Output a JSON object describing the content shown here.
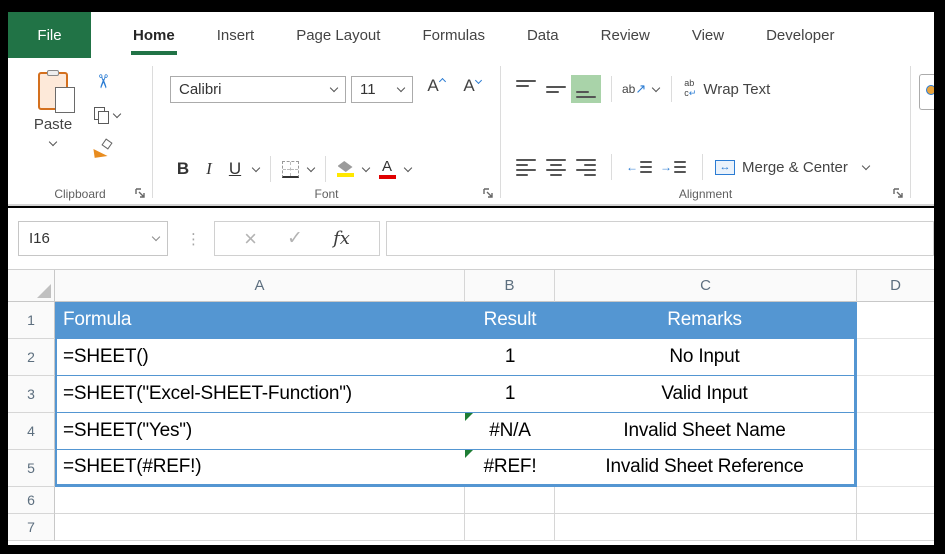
{
  "colors": {
    "excel_green": "#217346",
    "table_blue": "#5496d2",
    "selection_green": "#a9d3a9",
    "error_indicator_green": "#1e7d35",
    "fill_yellow": "#ffe800",
    "font_red": "#e00000"
  },
  "tabs": {
    "file": "File",
    "items": [
      {
        "label": "Home",
        "active": true
      },
      {
        "label": "Insert",
        "active": false
      },
      {
        "label": "Page Layout",
        "active": false
      },
      {
        "label": "Formulas",
        "active": false
      },
      {
        "label": "Data",
        "active": false
      },
      {
        "label": "Review",
        "active": false
      },
      {
        "label": "View",
        "active": false
      },
      {
        "label": "Developer",
        "active": false
      }
    ]
  },
  "ribbon": {
    "clipboard": {
      "label": "Clipboard",
      "paste_label": "Paste"
    },
    "font": {
      "label": "Font",
      "font_name": "Calibri",
      "font_size": "11",
      "bold": "B",
      "italic": "I",
      "underline": "U",
      "grow": "A",
      "shrink": "A",
      "color_a": "A"
    },
    "alignment": {
      "label": "Alignment",
      "wrap_text": "Wrap Text",
      "merge_center": "Merge & Center",
      "orientation_ab": "ab",
      "wrap_ab": "ab",
      "wrap_c": "c"
    }
  },
  "icons": {
    "cut": "✂",
    "cancel": "×",
    "check": "✓",
    "fx": "fx",
    "dots": "⋮",
    "orientation_arrow": "↗",
    "wrap_arrow": "↵",
    "merge_arrow": "↔",
    "indent_left": "←",
    "indent_right": "→"
  },
  "formula_bar": {
    "name_box_value": "I16",
    "formula_value": ""
  },
  "sheet": {
    "col_headers": [
      "A",
      "B",
      "C",
      "D"
    ],
    "row_headers": [
      "1",
      "2",
      "3",
      "4",
      "5",
      "6",
      "7"
    ],
    "table": {
      "header": {
        "formula": "Formula",
        "result": "Result",
        "remarks": "Remarks"
      },
      "rows": [
        {
          "formula": "=SHEET()",
          "result": "1",
          "remarks": "No Input",
          "error": false
        },
        {
          "formula": "=SHEET(\"Excel-SHEET-Function\")",
          "result": "1",
          "remarks": "Valid Input",
          "error": false
        },
        {
          "formula": "=SHEET(\"Yes\")",
          "result": "#N/A",
          "remarks": "Invalid Sheet Name",
          "error": true
        },
        {
          "formula": "=SHEET(#REF!)",
          "result": "#REF!",
          "remarks": "Invalid Sheet Reference",
          "error": true
        }
      ]
    }
  }
}
